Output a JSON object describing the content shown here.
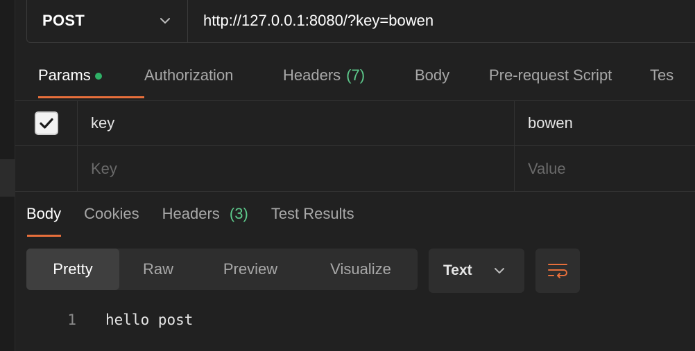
{
  "request": {
    "method": "POST",
    "url": "http://127.0.0.1:8080/?key=bowen"
  },
  "request_tabs": {
    "params": "Params",
    "authorization": "Authorization",
    "headers": "Headers",
    "headers_count": "(7)",
    "body": "Body",
    "prerequest": "Pre-request Script",
    "tests": "Tes"
  },
  "params": {
    "rows": [
      {
        "checked": true,
        "key": "key",
        "value": "bowen"
      }
    ],
    "new_row": {
      "key_placeholder": "Key",
      "value_placeholder": "Value"
    }
  },
  "response_tabs": {
    "body": "Body",
    "cookies": "Cookies",
    "headers": "Headers",
    "headers_count": "(3)",
    "test_results": "Test Results"
  },
  "response_toolbar": {
    "views": [
      "Pretty",
      "Raw",
      "Preview",
      "Visualize"
    ],
    "active_view": "Pretty",
    "format": "Text"
  },
  "response_body": {
    "lines": [
      {
        "number": "1",
        "text": "hello post"
      }
    ]
  },
  "colors": {
    "accent": "#e76f3b",
    "status_dot": "#2fb167",
    "count_green": "#5dc98b",
    "background": "#212121"
  },
  "icons": {
    "method_dropdown": "chevron-down-icon",
    "format_dropdown": "chevron-down-icon",
    "wrap": "wrap-lines-icon",
    "checkbox": "checkmark-icon"
  }
}
